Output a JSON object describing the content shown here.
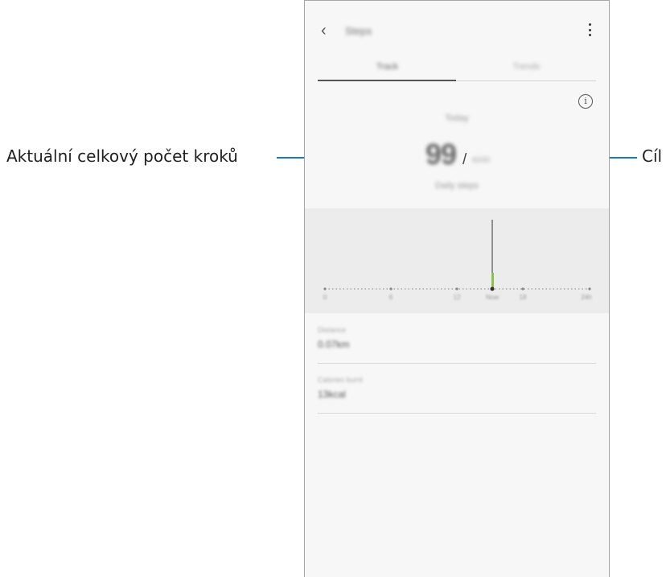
{
  "callouts": {
    "current_steps": "Aktuální celkový počet kroků",
    "goal": "Cíl"
  },
  "app": {
    "title": "Steps",
    "tabs": [
      "Track",
      "Trends"
    ]
  },
  "summary": {
    "period": "Today",
    "steps": "99",
    "separator": "/",
    "goal": "6000",
    "goal_label": "Daily steps"
  },
  "chart": {
    "x_ticks": [
      "0",
      "6",
      "12",
      "Now",
      "18",
      "24h"
    ],
    "current_steps": 99
  },
  "stats": [
    {
      "label": "Distance",
      "value": "0.07km"
    },
    {
      "label": "Calories burnt",
      "value": "13kcal"
    }
  ],
  "colors": {
    "accent": "#1e77b8",
    "bar": "#8bc34a"
  },
  "icons": {
    "back": "chevron-left-icon",
    "more": "more-vert-icon",
    "info": "info-icon"
  }
}
